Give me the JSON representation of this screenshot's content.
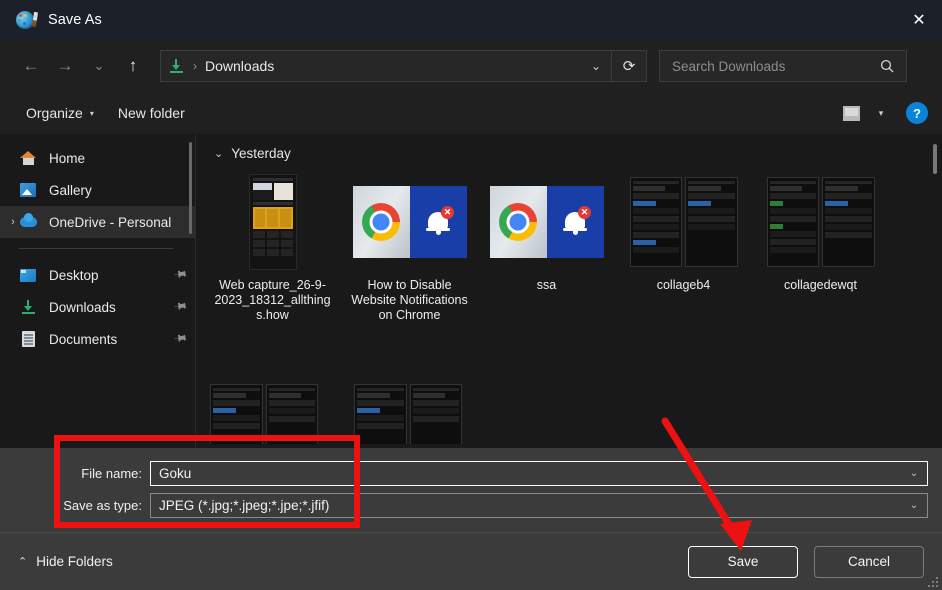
{
  "window": {
    "title": "Save As",
    "app_icon": "paint-palette-icon",
    "close_label": "✕"
  },
  "nav": {
    "back": "←",
    "forward": "→",
    "recent": "⌄",
    "up": "↑",
    "refresh": "⟳",
    "address_icon": "downloads-folder-icon",
    "breadcrumb_separator": "›",
    "breadcrumb": "Downloads",
    "address_chevron": "⌄"
  },
  "search": {
    "placeholder": "Search Downloads",
    "value": "",
    "icon": "search-icon"
  },
  "toolbar": {
    "organize_label": "Organize",
    "organize_caret": "▾",
    "new_folder_label": "New folder",
    "view_icon": "view-layout-icon",
    "view_caret": "▾",
    "help_label": "?"
  },
  "sidebar": {
    "items": [
      {
        "label": "Home",
        "icon": "home-icon",
        "pinned": false,
        "expandable": false,
        "selected": false
      },
      {
        "label": "Gallery",
        "icon": "gallery-icon",
        "pinned": false,
        "expandable": false,
        "selected": false
      },
      {
        "label": "OneDrive - Personal",
        "icon": "onedrive-cloud-icon",
        "pinned": false,
        "expandable": true,
        "selected": true,
        "expander": "›"
      },
      {
        "label": "Desktop",
        "icon": "desktop-icon",
        "pinned": true,
        "expandable": false,
        "selected": false
      },
      {
        "label": "Downloads",
        "icon": "downloads-icon",
        "pinned": true,
        "expandable": false,
        "selected": false
      },
      {
        "label": "Documents",
        "icon": "documents-icon",
        "pinned": true,
        "expandable": false,
        "selected": false
      }
    ],
    "pin_glyph": "📌"
  },
  "files": {
    "group_label": "Yesterday",
    "group_chevron": "⌄",
    "items": [
      {
        "name": "Web capture_26-9-2023_18312_allthings.how",
        "thumb": "webpage-capture-thumbnail"
      },
      {
        "name": "How to Disable Website Notifications on Chrome",
        "thumb": "chrome-notification-thumbnail"
      },
      {
        "name": "ssa",
        "thumb": "chrome-notification-thumbnail"
      },
      {
        "name": "collageb4",
        "thumb": "phone-collage-thumbnail"
      },
      {
        "name": "collagedewqt",
        "thumb": "phone-collage-thumbnail"
      }
    ]
  },
  "form": {
    "file_name_label": "File name:",
    "file_name_value": "Goku",
    "save_as_type_label": "Save as type:",
    "save_as_type_value": "JPEG (*.jpg;*.jpeg;*.jpe;*.jfif)",
    "dropdown_caret": "⌄"
  },
  "footer": {
    "hide_folders_label": "Hide Folders",
    "hide_folders_chevron": "⌃",
    "save_label": "Save",
    "cancel_label": "Cancel"
  },
  "annotations": {
    "highlight_color": "#ee1111",
    "box_target": "file-name-and-type-fields",
    "arrow_target": "save-button"
  }
}
